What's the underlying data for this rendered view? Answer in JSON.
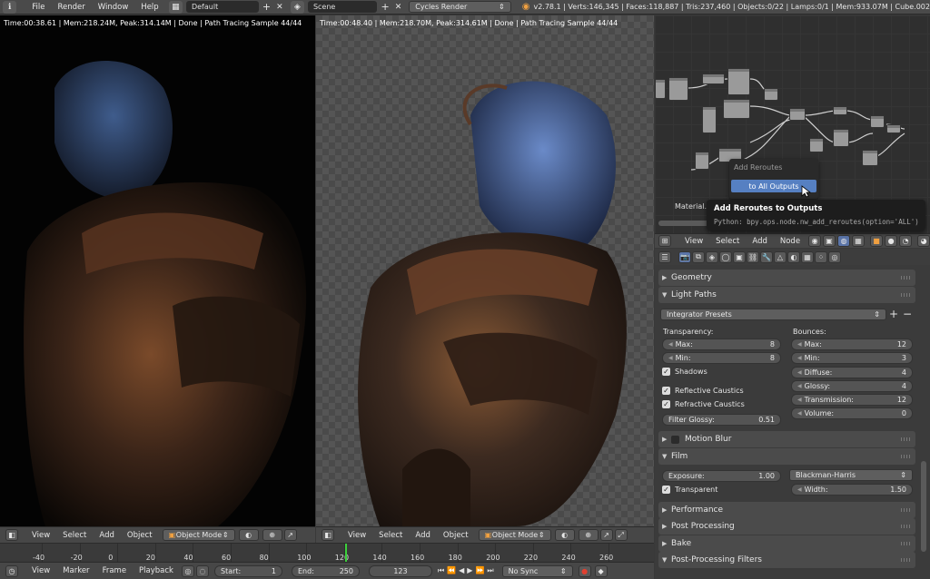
{
  "top": {
    "menu": [
      "File",
      "Render",
      "Window",
      "Help"
    ],
    "layout": "Default",
    "scene": "Scene",
    "engine": "Cycles Render",
    "stats": "v2.78.1 | Verts:146,345 | Faces:118,887 | Tris:237,460 | Objects:0/22 | Lamps:0/1 | Mem:933.07M | Cube.002"
  },
  "viewport_left": {
    "info": "Time:00:38.61 | Mem:218.24M, Peak:314.14M | Done | Path Tracing Sample 44/44"
  },
  "viewport_right": {
    "info": "Time:00:48.40 | Mem:218.70M, Peak:314.61M | Done | Path Tracing Sample 44/44"
  },
  "view3d_header": {
    "menus": [
      "View",
      "Select",
      "Add",
      "Object"
    ],
    "mode": "Object Mode"
  },
  "timeline": {
    "ticks": [
      "-40",
      "-20",
      "0",
      "20",
      "40",
      "60",
      "80",
      "100",
      "120",
      "140",
      "160",
      "180",
      "200",
      "220",
      "240",
      "260"
    ],
    "menus": [
      "View",
      "Marker",
      "Frame",
      "Playback"
    ],
    "start_label": "Start:",
    "start": "1",
    "end_label": "End:",
    "end": "250",
    "current": "123",
    "sync": "No Sync"
  },
  "node_editor": {
    "menus": [
      "View",
      "Select",
      "Add",
      "Node"
    ],
    "material_label": "Material.0"
  },
  "popup": {
    "title": "Add Reroutes",
    "item": "to All Outputs"
  },
  "tooltip": {
    "title": "Add Reroutes to Outputs",
    "python": "Python: bpy.ops.node.nw_add_reroutes(option='ALL')"
  },
  "properties": {
    "geometry": "Geometry",
    "light_paths": "Light Paths",
    "integrator_presets": "Integrator Presets",
    "transparency_label": "Transparency:",
    "bounces_label": "Bounces:",
    "t_max_label": "Max:",
    "t_max": "8",
    "t_min_label": "Min:",
    "t_min": "8",
    "shadows": "Shadows",
    "reflective_caustics": "Reflective Caustics",
    "refractive_caustics": "Refractive Caustics",
    "filter_glossy_label": "Filter Glossy:",
    "filter_glossy": "0.51",
    "b_max_label": "Max:",
    "b_max": "12",
    "b_min_label": "Min:",
    "b_min": "3",
    "diffuse_label": "Diffuse:",
    "diffuse": "4",
    "glossy_label": "Glossy:",
    "glossy": "4",
    "transmission_label": "Transmission:",
    "transmission": "12",
    "volume_label": "Volume:",
    "volume": "0",
    "motion_blur": "Motion Blur",
    "film": "Film",
    "exposure_label": "Exposure:",
    "exposure": "1.00",
    "filter_type": "Blackman-Harris",
    "transparent": "Transparent",
    "width_label": "Width:",
    "width": "1.50",
    "performance": "Performance",
    "post_processing": "Post Processing",
    "bake": "Bake",
    "post_processing_filters": "Post-Processing Filters"
  }
}
